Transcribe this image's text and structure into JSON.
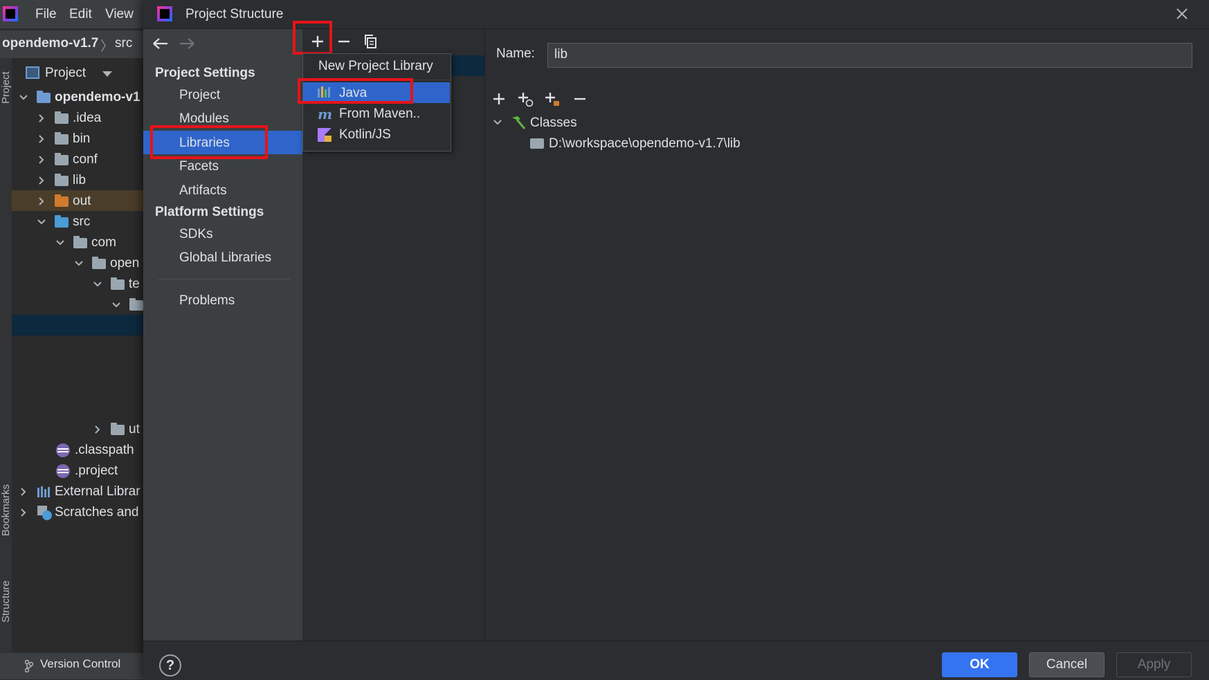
{
  "ide": {
    "menu": [
      {
        "label": "File"
      },
      {
        "label": "Edit"
      },
      {
        "label": "View"
      }
    ],
    "breadcrumb": {
      "root": "opendemo-v1.7",
      "sep": "〉",
      "second": "src"
    },
    "project_panel": {
      "title": "Project",
      "tree": [
        {
          "label": "opendemo-v1",
          "bold": true
        },
        {
          "label": ".idea"
        },
        {
          "label": "bin"
        },
        {
          "label": "conf"
        },
        {
          "label": "lib"
        },
        {
          "label": "out"
        },
        {
          "label": "src"
        },
        {
          "label": "com"
        },
        {
          "label": "open"
        },
        {
          "label": "te"
        },
        {
          "label": "ut"
        },
        {
          "label": ".classpath"
        },
        {
          "label": ".project"
        },
        {
          "label": "External Librar"
        },
        {
          "label": "Scratches and"
        }
      ]
    },
    "stripe_labels": {
      "project": "Project",
      "bookmarks": "Bookmarks",
      "structure": "Structure"
    },
    "version_control": "Version Control"
  },
  "dialog": {
    "title": "Project Structure",
    "nav": {
      "project_settings_header": "Project Settings",
      "project_settings": [
        {
          "label": "Project"
        },
        {
          "label": "Modules"
        },
        {
          "label": "Libraries"
        },
        {
          "label": "Facets"
        },
        {
          "label": "Artifacts"
        }
      ],
      "platform_settings_header": "Platform Settings",
      "platform_settings": [
        {
          "label": "SDKs"
        },
        {
          "label": "Global Libraries"
        }
      ],
      "problems": "Problems"
    },
    "popup": {
      "title": "New Project Library",
      "items": [
        {
          "label": "Java"
        },
        {
          "label": "From Maven.."
        },
        {
          "label": "Kotlin/JS"
        }
      ]
    },
    "detail": {
      "name_label": "Name:",
      "name_value": "lib",
      "classes_label": "Classes",
      "class_path": "D:\\workspace\\opendemo-v1.7\\lib"
    },
    "footer": {
      "help": "?",
      "ok": "OK",
      "cancel": "Cancel",
      "apply": "Apply"
    }
  },
  "colors": {
    "selection": "#2f65ca",
    "highlight": "#e8121a",
    "ok_button": "#3574f0"
  }
}
